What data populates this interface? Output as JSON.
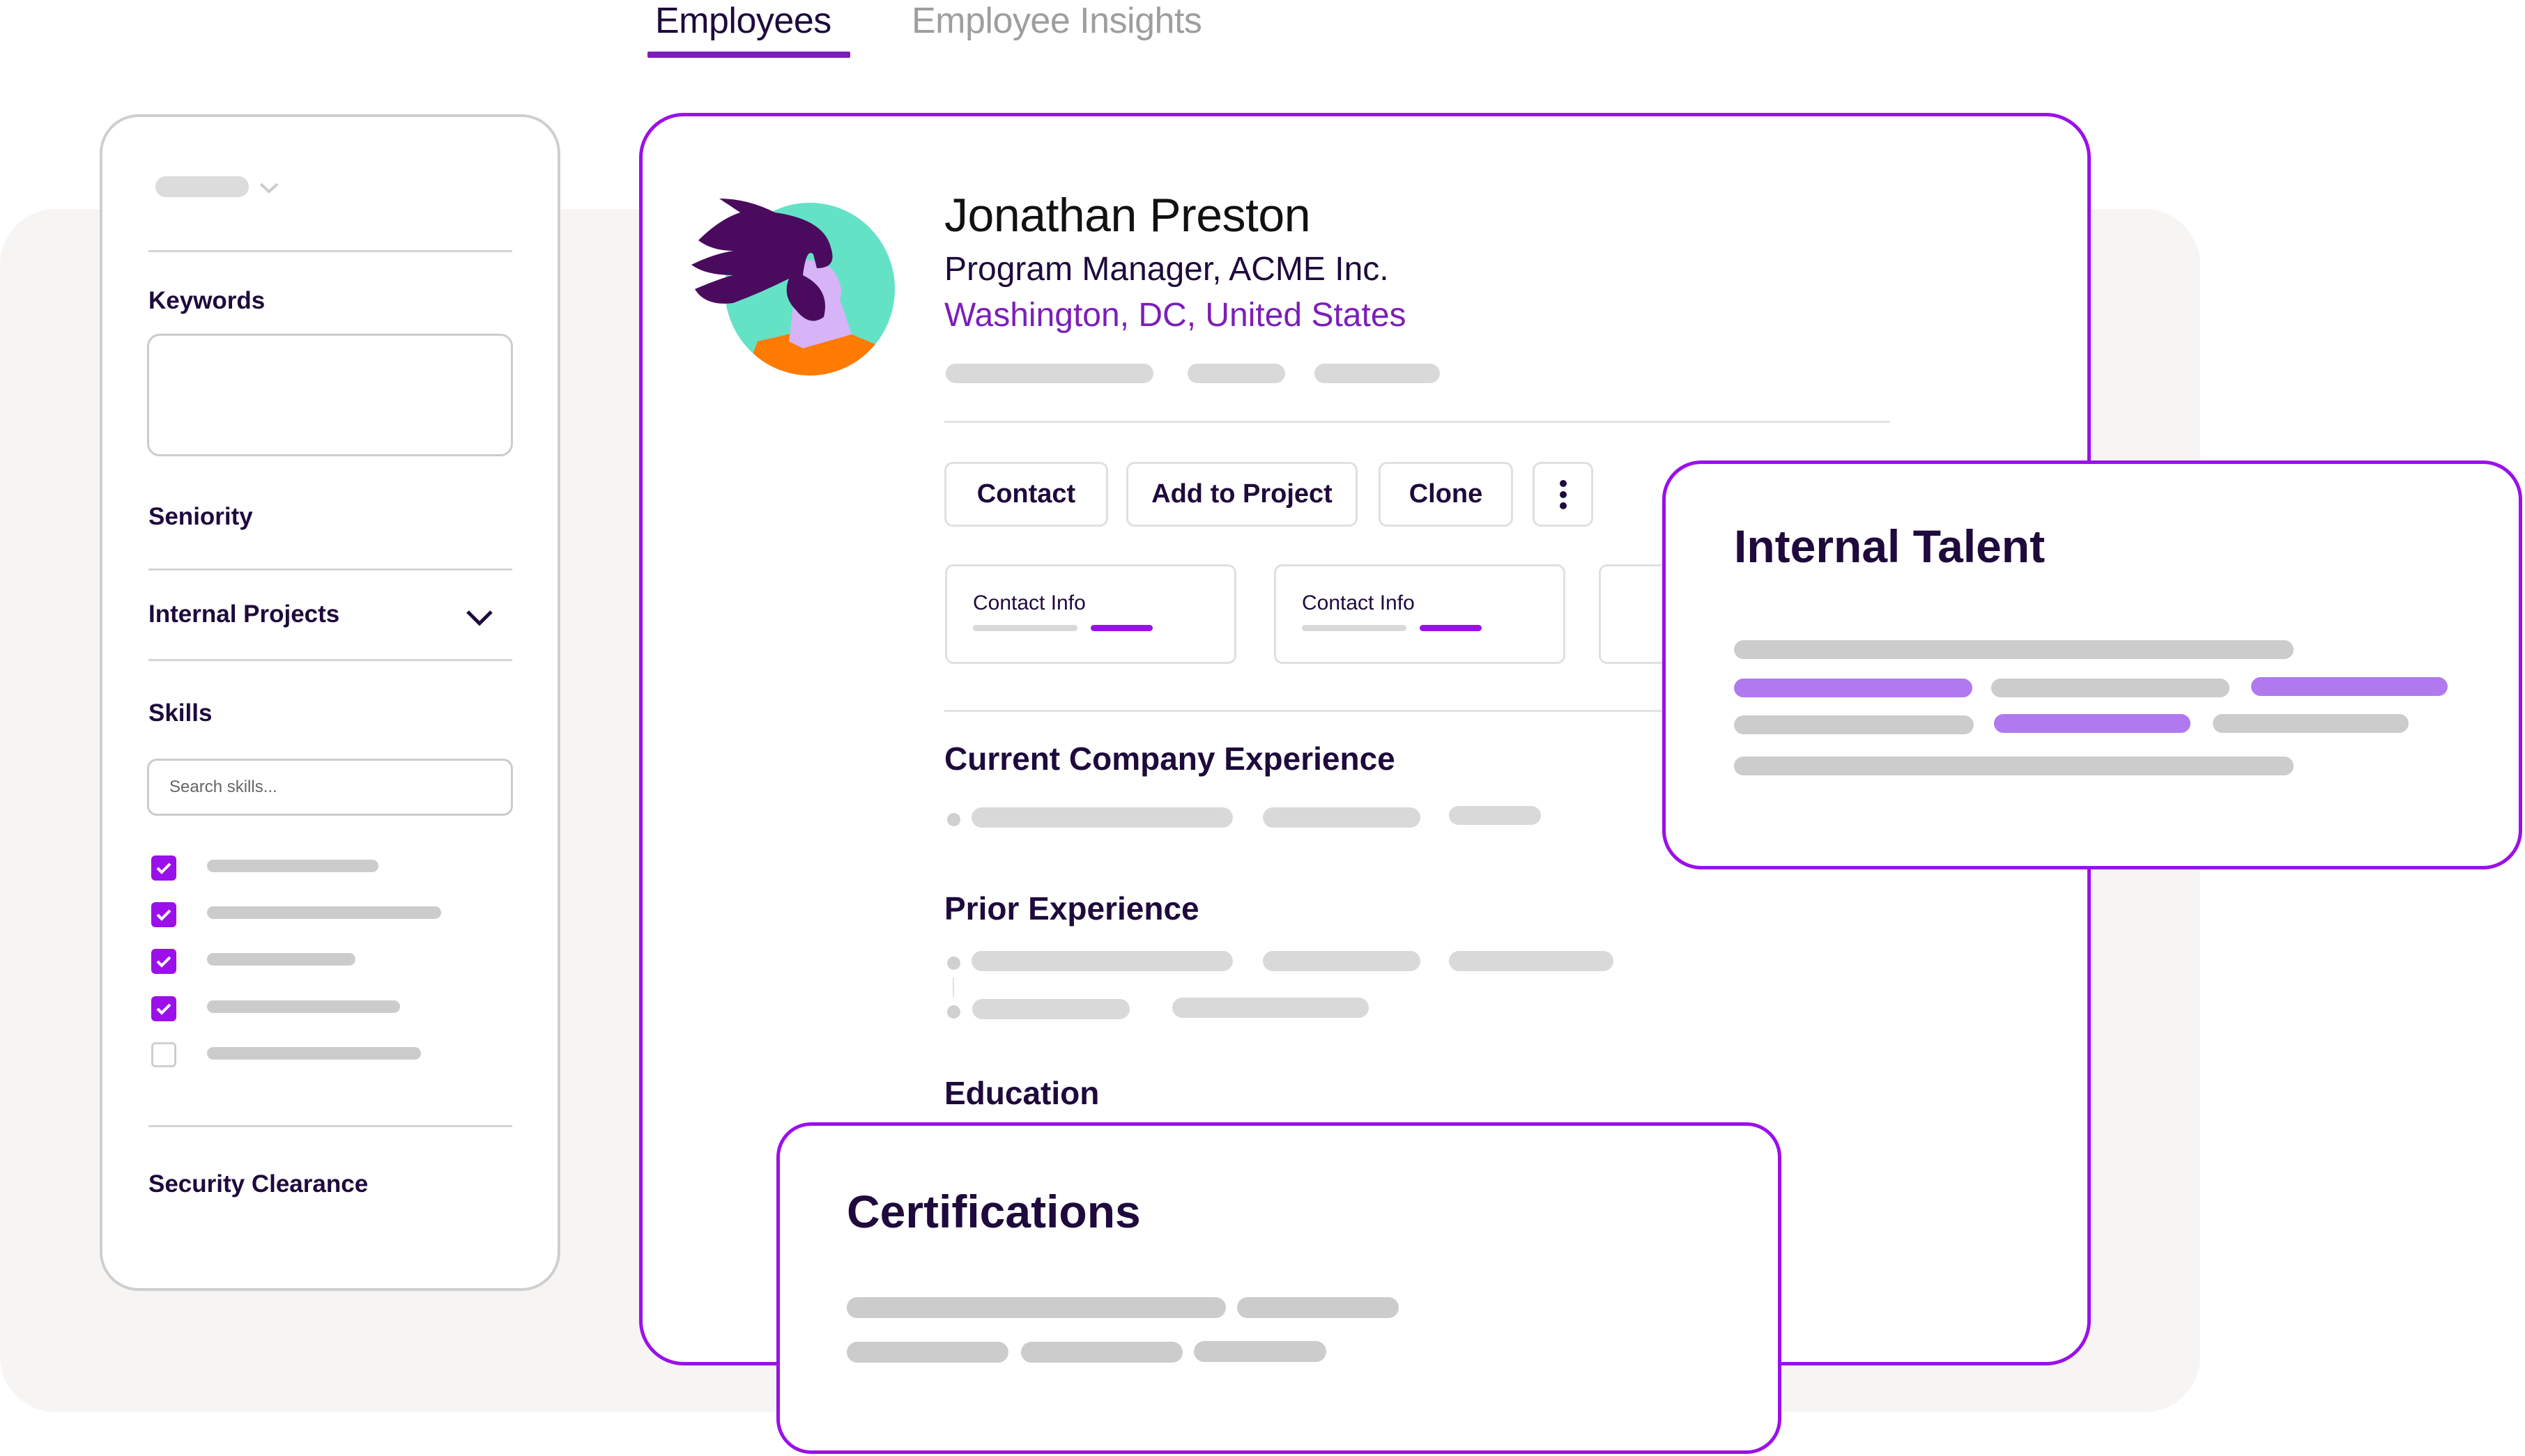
{
  "tabs": [
    {
      "label": "Employees",
      "active": true
    },
    {
      "label": "Employee Insights",
      "active": false
    }
  ],
  "filters": {
    "select_icon": "chevron-down-icon",
    "keywords": {
      "label": "Keywords",
      "value": ""
    },
    "seniority": {
      "label": "Seniority"
    },
    "internal_projects": {
      "label": "Internal Projects",
      "icon": "chevron-down-icon"
    },
    "skills": {
      "label": "Skills",
      "search_placeholder": "Search skills...",
      "options": [
        {
          "checked": true
        },
        {
          "checked": true
        },
        {
          "checked": true
        },
        {
          "checked": true
        },
        {
          "checked": false
        }
      ]
    },
    "security_clearance": {
      "label": "Security Clearance"
    }
  },
  "profile": {
    "name": "Jonathan Preston",
    "role": "Program Manager, ACME Inc.",
    "location": "Washington, DC,  United States",
    "avatar_icon": "person-avatar-icon",
    "colors": {
      "accent": "#9b10ea",
      "location": "#7b1fb8",
      "avatar_bg": "#63e2c6",
      "avatar_shirt": "#ff7a00",
      "avatar_hair": "#4a0b5e"
    }
  },
  "actions": {
    "contact": "Contact",
    "add_to_project": "Add to Project",
    "clone": "Clone",
    "more_icon": "more-vertical-icon"
  },
  "info_cards": [
    {
      "label": "Contact Info"
    },
    {
      "label": "Contact Info"
    },
    {
      "label": ""
    }
  ],
  "sections": {
    "current_experience": "Current Company Experience",
    "prior_experience": "Prior Experience",
    "education": "Education"
  },
  "internal_talent": {
    "title": "Internal Talent"
  },
  "certifications": {
    "title": "Certifications"
  }
}
